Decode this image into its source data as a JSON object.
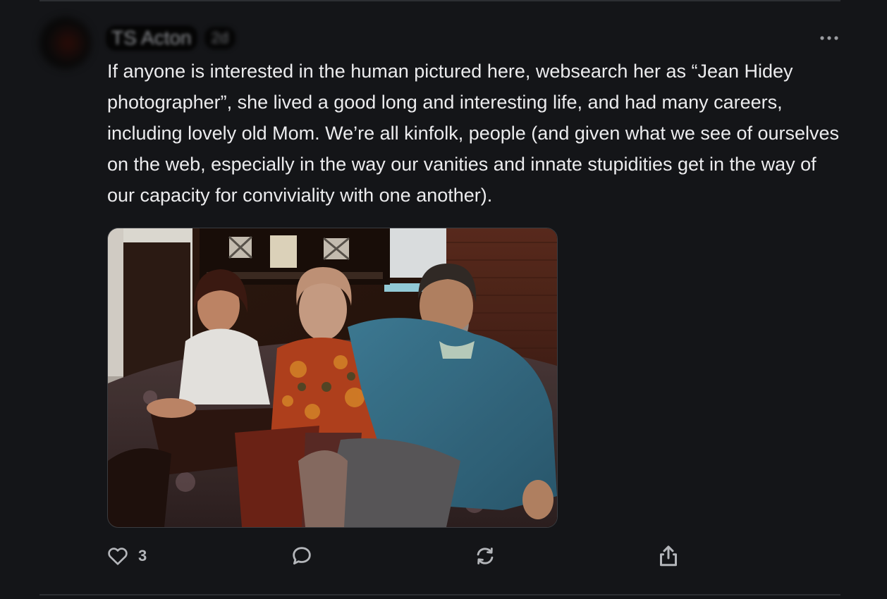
{
  "comment": {
    "author": "TS Acton",
    "time": "2d",
    "text": "If anyone is interested in the human pictured here, websearch her as “Jean Hidey photographer”, she lived a good long and interesting life, and had many careers, including lovely old Mom. We’re all kinfolk, people (and given what we see of ourselves on the web, especially in the way our vanities and innate stupidities get in the way of our capacity for conviviality with one another)."
  },
  "actions": {
    "like": {
      "icon": "heart-icon",
      "count": "3"
    },
    "reply": {
      "icon": "speech-bubble-icon"
    },
    "restack": {
      "icon": "restack-arrows-icon"
    },
    "share": {
      "icon": "share-upload-icon"
    },
    "more": {
      "icon": "ellipsis-icon"
    }
  },
  "photo": {
    "subject": "three-people-on-couch"
  },
  "colors": {
    "background": "#141518",
    "text": "#ececee",
    "icon": "#b4b6ba",
    "divider": "#2d2f33"
  }
}
